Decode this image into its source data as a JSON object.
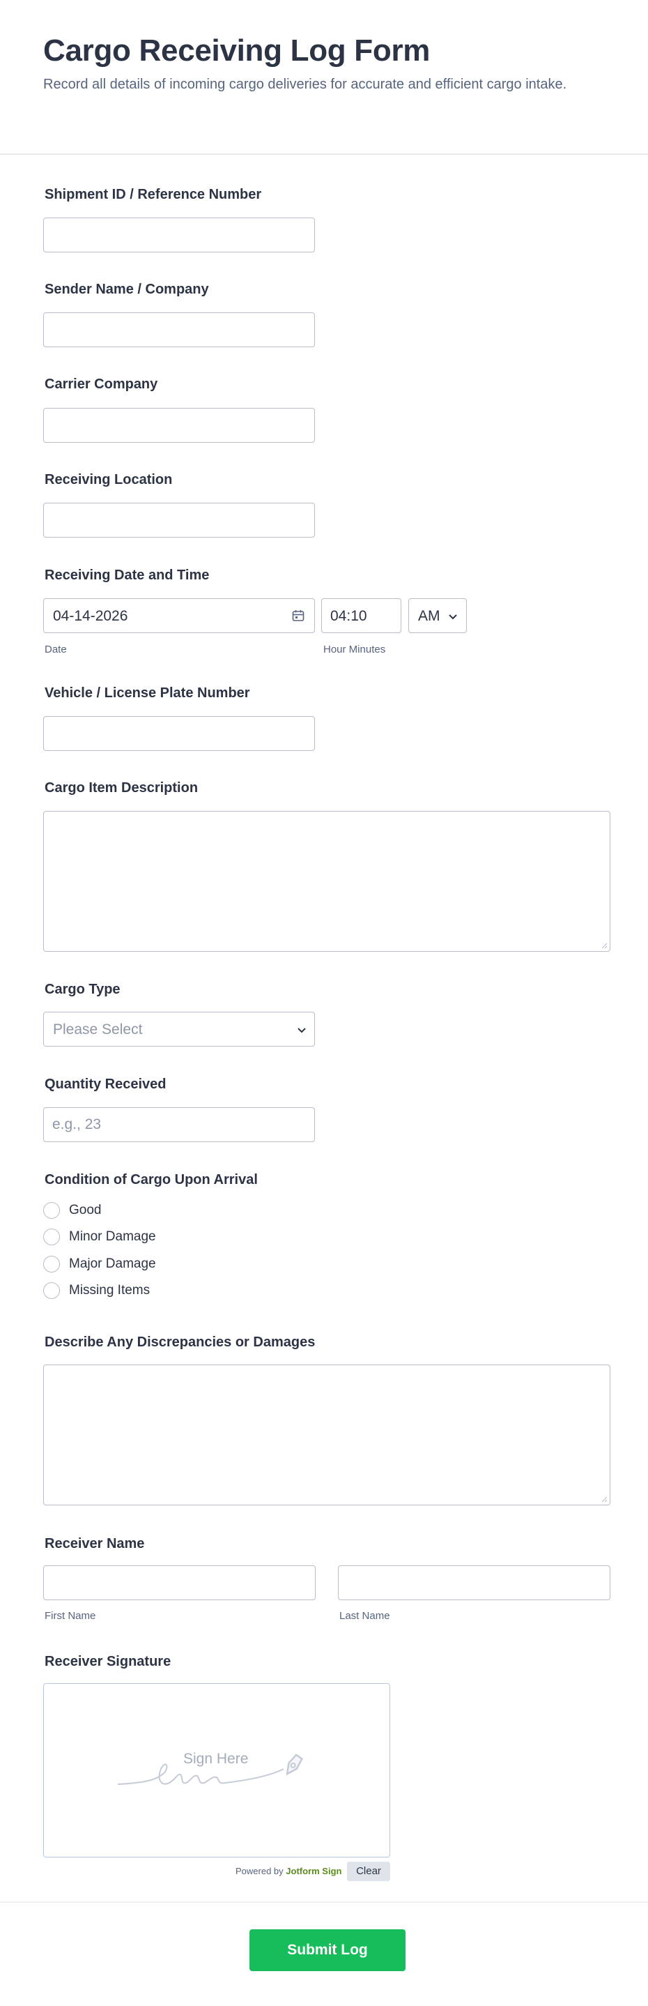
{
  "form": {
    "title": "Cargo Receiving Log Form",
    "subtitle": "Record all details of incoming cargo deliveries for accurate and efficient cargo intake."
  },
  "fields": {
    "shipment_id": {
      "label": "Shipment ID / Reference Number",
      "value": ""
    },
    "sender": {
      "label": "Sender Name / Company",
      "value": ""
    },
    "carrier": {
      "label": "Carrier Company",
      "value": ""
    },
    "location": {
      "label": "Receiving Location",
      "value": ""
    },
    "datetime": {
      "label": "Receiving Date and Time",
      "date_value": "04-14-2026",
      "date_sublabel": "Date",
      "time_value": "04:10",
      "time_sublabel": "Hour Minutes",
      "ampm_value": "AM"
    },
    "vehicle": {
      "label": "Vehicle / License Plate Number",
      "value": ""
    },
    "description": {
      "label": "Cargo Item Description"
    },
    "cargo_type": {
      "label": "Cargo Type",
      "selected": "Please Select"
    },
    "quantity": {
      "label": "Quantity Received",
      "placeholder": "e.g., 23"
    },
    "condition": {
      "label": "Condition of Cargo Upon Arrival",
      "options": [
        "Good",
        "Minor Damage",
        "Major Damage",
        "Missing Items"
      ]
    },
    "discrepancies": {
      "label": "Describe Any Discrepancies or Damages"
    },
    "receiver_name": {
      "label": "Receiver Name",
      "first_sublabel": "First Name",
      "last_sublabel": "Last Name"
    },
    "signature": {
      "label": "Receiver Signature",
      "placeholder": "Sign Here",
      "powered_prefix": "Powered by",
      "powered_brand": "Jotform Sign",
      "clear_label": "Clear"
    }
  },
  "submit_label": "Submit Log",
  "colors": {
    "accent": "#18bd5b",
    "text": "#2c3345",
    "muted": "#57647e",
    "border": "#b8bdc9",
    "brand_green": "#5b8c1e"
  }
}
